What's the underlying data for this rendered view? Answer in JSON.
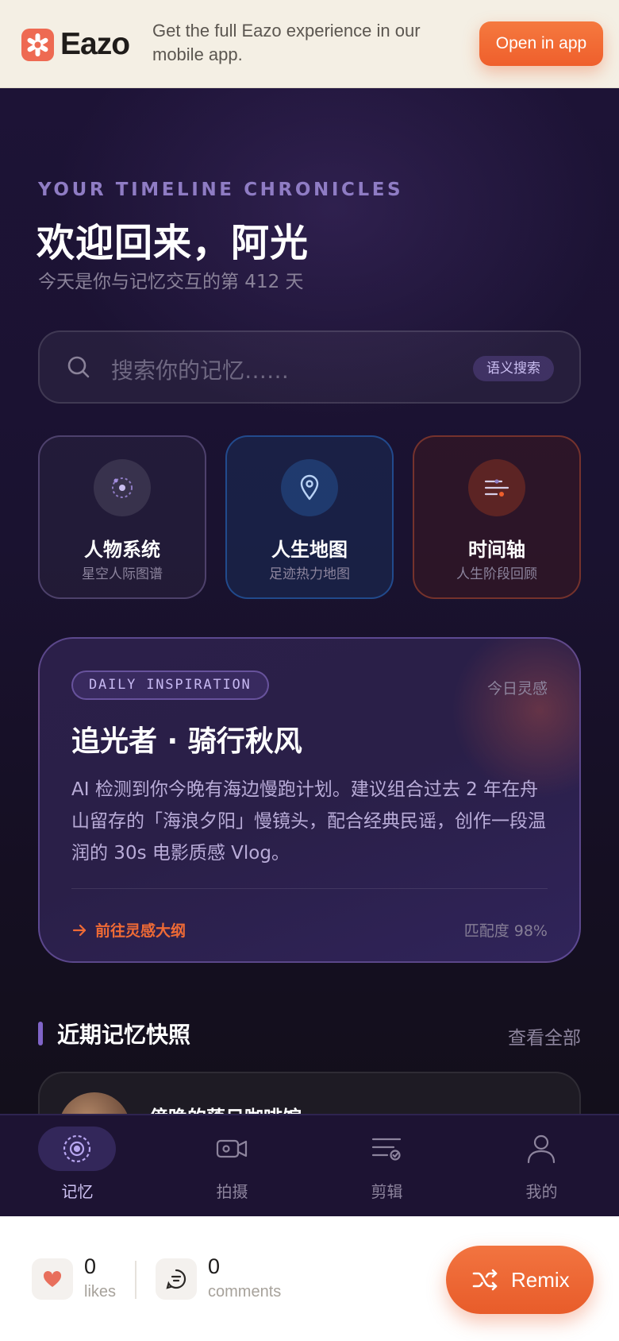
{
  "banner": {
    "brand": "Eazo",
    "text": "Get the full Eazo experience in our mobile app.",
    "open_label": "Open in app"
  },
  "hero": {
    "eyebrow": "YOUR TIMELINE CHRONICLES",
    "greeting": "欢迎回来，阿光",
    "subtitle": "今天是你与记忆交互的第 412 天"
  },
  "search": {
    "placeholder": "搜索你的记忆……",
    "chip": "语义搜索"
  },
  "features": [
    {
      "title": "人物系统",
      "subtitle": "星空人际图谱",
      "icon": "orbit-icon"
    },
    {
      "title": "人生地图",
      "subtitle": "足迹热力地图",
      "icon": "map-pin-icon"
    },
    {
      "title": "时间轴",
      "subtitle": "人生阶段回顾",
      "icon": "timeline-sliders-icon"
    }
  ],
  "inspiration": {
    "chip": "DAILY INSPIRATION",
    "tag": "今日灵感",
    "title": "追光者 · 骑行秋风",
    "body": "AI 检测到你今晚有海边慢跑计划。建议组合过去 2 年在舟山留存的「海浪夕阳」慢镜头，配合经典民谣，创作一段温润的 30s 电影质感 Vlog。",
    "cta": "前往灵感大纲",
    "match": "匹配度 98%"
  },
  "recent": {
    "title": "近期记忆快照",
    "see_all": "查看全部",
    "items": [
      {
        "title": "傍晚的落日咖啡馆"
      }
    ]
  },
  "nav": [
    {
      "label": "记忆",
      "icon": "memory-orbit-icon",
      "active": true
    },
    {
      "label": "拍摄",
      "icon": "video-camera-icon",
      "active": false
    },
    {
      "label": "剪辑",
      "icon": "edit-list-icon",
      "active": false
    },
    {
      "label": "我的",
      "icon": "user-icon",
      "active": false
    }
  ],
  "footer": {
    "likes_count": "0",
    "likes_label": "likes",
    "comments_count": "0",
    "comments_label": "comments",
    "remix_label": "Remix"
  },
  "colors": {
    "accent_orange": "#ef5f2c",
    "accent_purple": "#8064c8",
    "app_background": "#1a1230",
    "banner_background": "#f4efe4"
  }
}
